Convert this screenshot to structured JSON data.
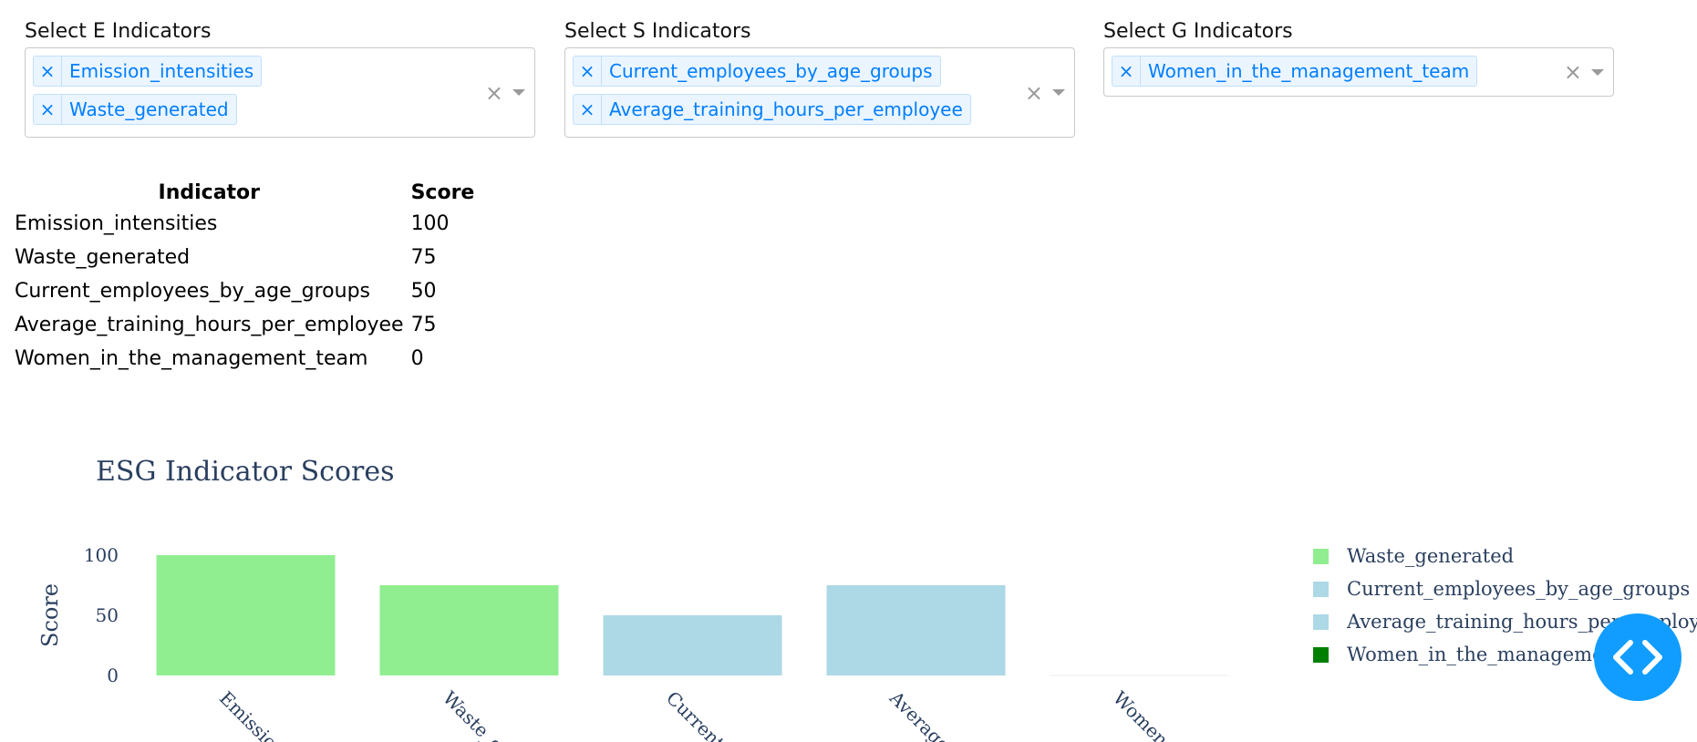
{
  "dropdowns": [
    {
      "label": "Select E Indicators",
      "selected": [
        "Emission_intensities",
        "Waste_generated"
      ]
    },
    {
      "label": "Select S Indicators",
      "selected": [
        "Current_employees_by_age_groups",
        "Average_training_hours_per_employee"
      ]
    },
    {
      "label": "Select G Indicators",
      "selected": [
        "Women_in_the_management_team"
      ]
    }
  ],
  "chip_remove_glyph": "×",
  "clear_glyph": "×",
  "table": {
    "headers": [
      "Indicator",
      "Score"
    ],
    "rows": [
      [
        "Emission_intensities",
        "100"
      ],
      [
        "Waste_generated",
        "75"
      ],
      [
        "Current_employees_by_age_groups",
        "50"
      ],
      [
        "Average_training_hours_per_employee",
        "75"
      ],
      [
        "Women_in_the_management_team",
        "0"
      ]
    ]
  },
  "chart_data": {
    "type": "bar",
    "title": "ESG Indicator Scores",
    "xlabel": "",
    "ylabel": "Score",
    "ylim": [
      0,
      100
    ],
    "yticks": [
      0,
      50,
      100
    ],
    "categories": [
      "Emission_intensities",
      "Waste_generated",
      "Current_employees_by_age_groups",
      "Average_training_hours_per_employee",
      "Women_in_the_management_team"
    ],
    "visible_tick_labels": [
      "Emissio",
      "Waste_g",
      "Current",
      "Average",
      "Women_"
    ],
    "values": [
      100,
      75,
      50,
      75,
      0
    ],
    "colors": [
      "#90ee90",
      "#90ee90",
      "#add8e6",
      "#add8e6",
      "#008000"
    ],
    "legend": {
      "placement": "right",
      "visible_entries": [
        {
          "label": "Waste_generated",
          "color": "#90ee90"
        },
        {
          "label": "Current_employees_by_age_groups",
          "color": "#add8e6"
        },
        {
          "label": "Average_training_hours_per_employee",
          "color": "#add8e6"
        },
        {
          "label": "Women_in_the_management_team",
          "color": "#008000"
        }
      ]
    }
  },
  "fab": {
    "icon": "code-brackets-icon",
    "color": "#119dff"
  }
}
